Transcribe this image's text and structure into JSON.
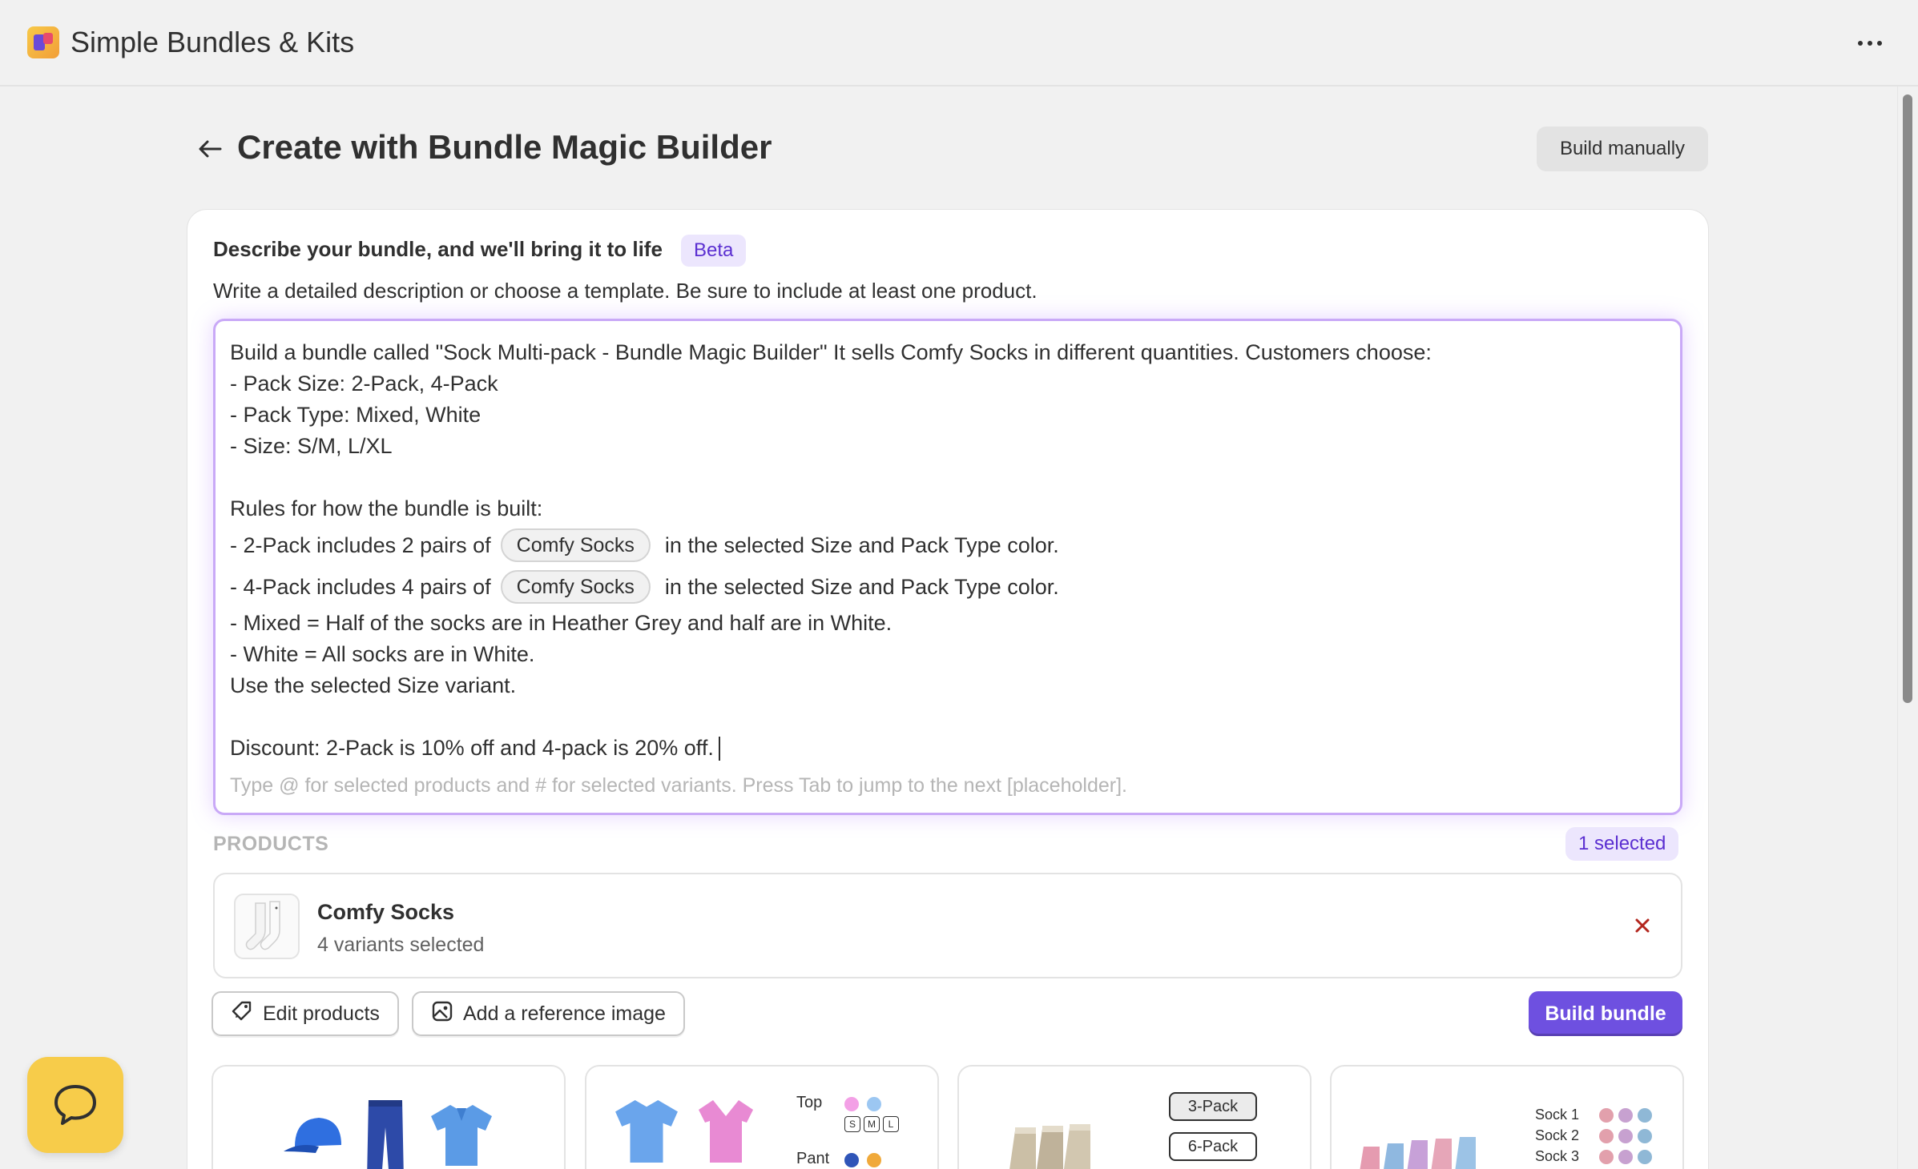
{
  "app": {
    "title": "Simple Bundles & Kits",
    "logo_icon": "app-logo-icon",
    "menu_icon": "more-horizontal-icon"
  },
  "header": {
    "title": "Create with Bundle Magic Builder",
    "back_icon": "arrow-left-icon",
    "build_manually_label": "Build manually"
  },
  "describe": {
    "heading": "Describe your bundle, and we'll bring it to life",
    "badge": "Beta",
    "subtext": "Write a detailed description or choose a template. Be sure to include at least one product."
  },
  "editor": {
    "lines": {
      "l1": "Build a bundle called \"Sock Multi-pack - Bundle Magic Builder\" It sells Comfy Socks in different quantities. Customers choose:",
      "l2": "- Pack Size: 2-Pack, 4-Pack",
      "l3": "- Pack Type: Mixed, White",
      "l4": "- Size: S/M, L/XL",
      "l6": "Rules for how the bundle is built:",
      "l7a": "- 2-Pack includes 2 pairs of",
      "l7chip": "Comfy Socks",
      "l7b": "in the selected Size and Pack Type color.",
      "l8a": "- 4-Pack includes 4 pairs of",
      "l8chip": "Comfy Socks",
      "l8b": "in the selected Size and Pack Type color.",
      "l9": "- Mixed = Half of the socks are in Heather Grey and half are in White.",
      "l10": "- White = All socks are in White.",
      "l11": "Use the selected Size variant.",
      "l13": "Discount: 2-Pack is 10% off and 4-pack is 20% off."
    },
    "placeholder": "Type @ for selected products and # for selected variants. Press Tab to jump to the next [placeholder]."
  },
  "products": {
    "label": "PRODUCTS",
    "selected_badge": "1 selected",
    "items": [
      {
        "name": "Comfy Socks",
        "variants": "4 variants selected",
        "thumb_icon": "socks-icon",
        "remove_icon": "close-icon"
      }
    ]
  },
  "actions": {
    "edit_products": "Edit products",
    "edit_icon": "tag-edit-icon",
    "add_reference": "Add a reference image",
    "image_icon": "image-icon",
    "build_bundle": "Build bundle"
  },
  "templates": {
    "t2": {
      "top_label": "Top",
      "pant_label": "Pant",
      "sizes": [
        "S",
        "M",
        "L"
      ]
    },
    "t3": {
      "pack_1": "3-Pack",
      "pack_2": "6-Pack"
    },
    "t4": {
      "sock_1": "Sock 1",
      "sock_2": "Sock 2",
      "sock_3": "Sock 3"
    }
  },
  "colors": {
    "accent": "#6e50e0",
    "badge_bg": "#ece6fd",
    "badge_text": "#5b2fd1",
    "editor_border": "#c9a9f7",
    "chat_button": "#f7cc4a",
    "remove_icon": "#b3261e"
  },
  "chat": {
    "icon": "chat-bubble-icon"
  }
}
